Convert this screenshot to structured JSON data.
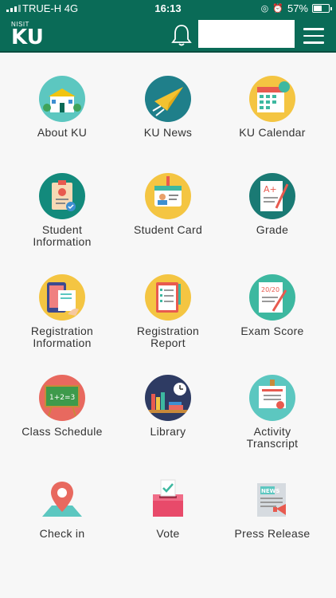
{
  "status": {
    "carrier": "TRUE-H  4G",
    "time": "16:13",
    "battery": "57%",
    "battery_level": 0.57
  },
  "header": {
    "logo_small": "NISIT",
    "logo_big": "KU"
  },
  "menu_items": [
    {
      "label": "About KU"
    },
    {
      "label": "KU News"
    },
    {
      "label": "KU Calendar"
    },
    {
      "label": "Student\nInformation"
    },
    {
      "label": "Student Card"
    },
    {
      "label": "Grade"
    },
    {
      "label": "Registration\nInformation"
    },
    {
      "label": "Registration\nReport"
    },
    {
      "label": "Exam Score"
    },
    {
      "label": "Class Schedule"
    },
    {
      "label": "Library"
    },
    {
      "label": "Activity\nTranscript"
    },
    {
      "label": "Check in"
    },
    {
      "label": "Vote"
    },
    {
      "label": "Press Release"
    }
  ],
  "icons": [
    "building-icon",
    "paper-plane-icon",
    "calendar-icon",
    "clipboard-icon",
    "id-card-icon",
    "grade-paper-icon",
    "registration-phone-icon",
    "checklist-icon",
    "exam-score-icon",
    "chalkboard-icon",
    "bookshelf-icon",
    "certificate-icon",
    "map-pin-icon",
    "ballot-box-icon",
    "newspaper-icon"
  ],
  "colors": {
    "header": "#0a6b57",
    "background": "#f7f7f7"
  }
}
